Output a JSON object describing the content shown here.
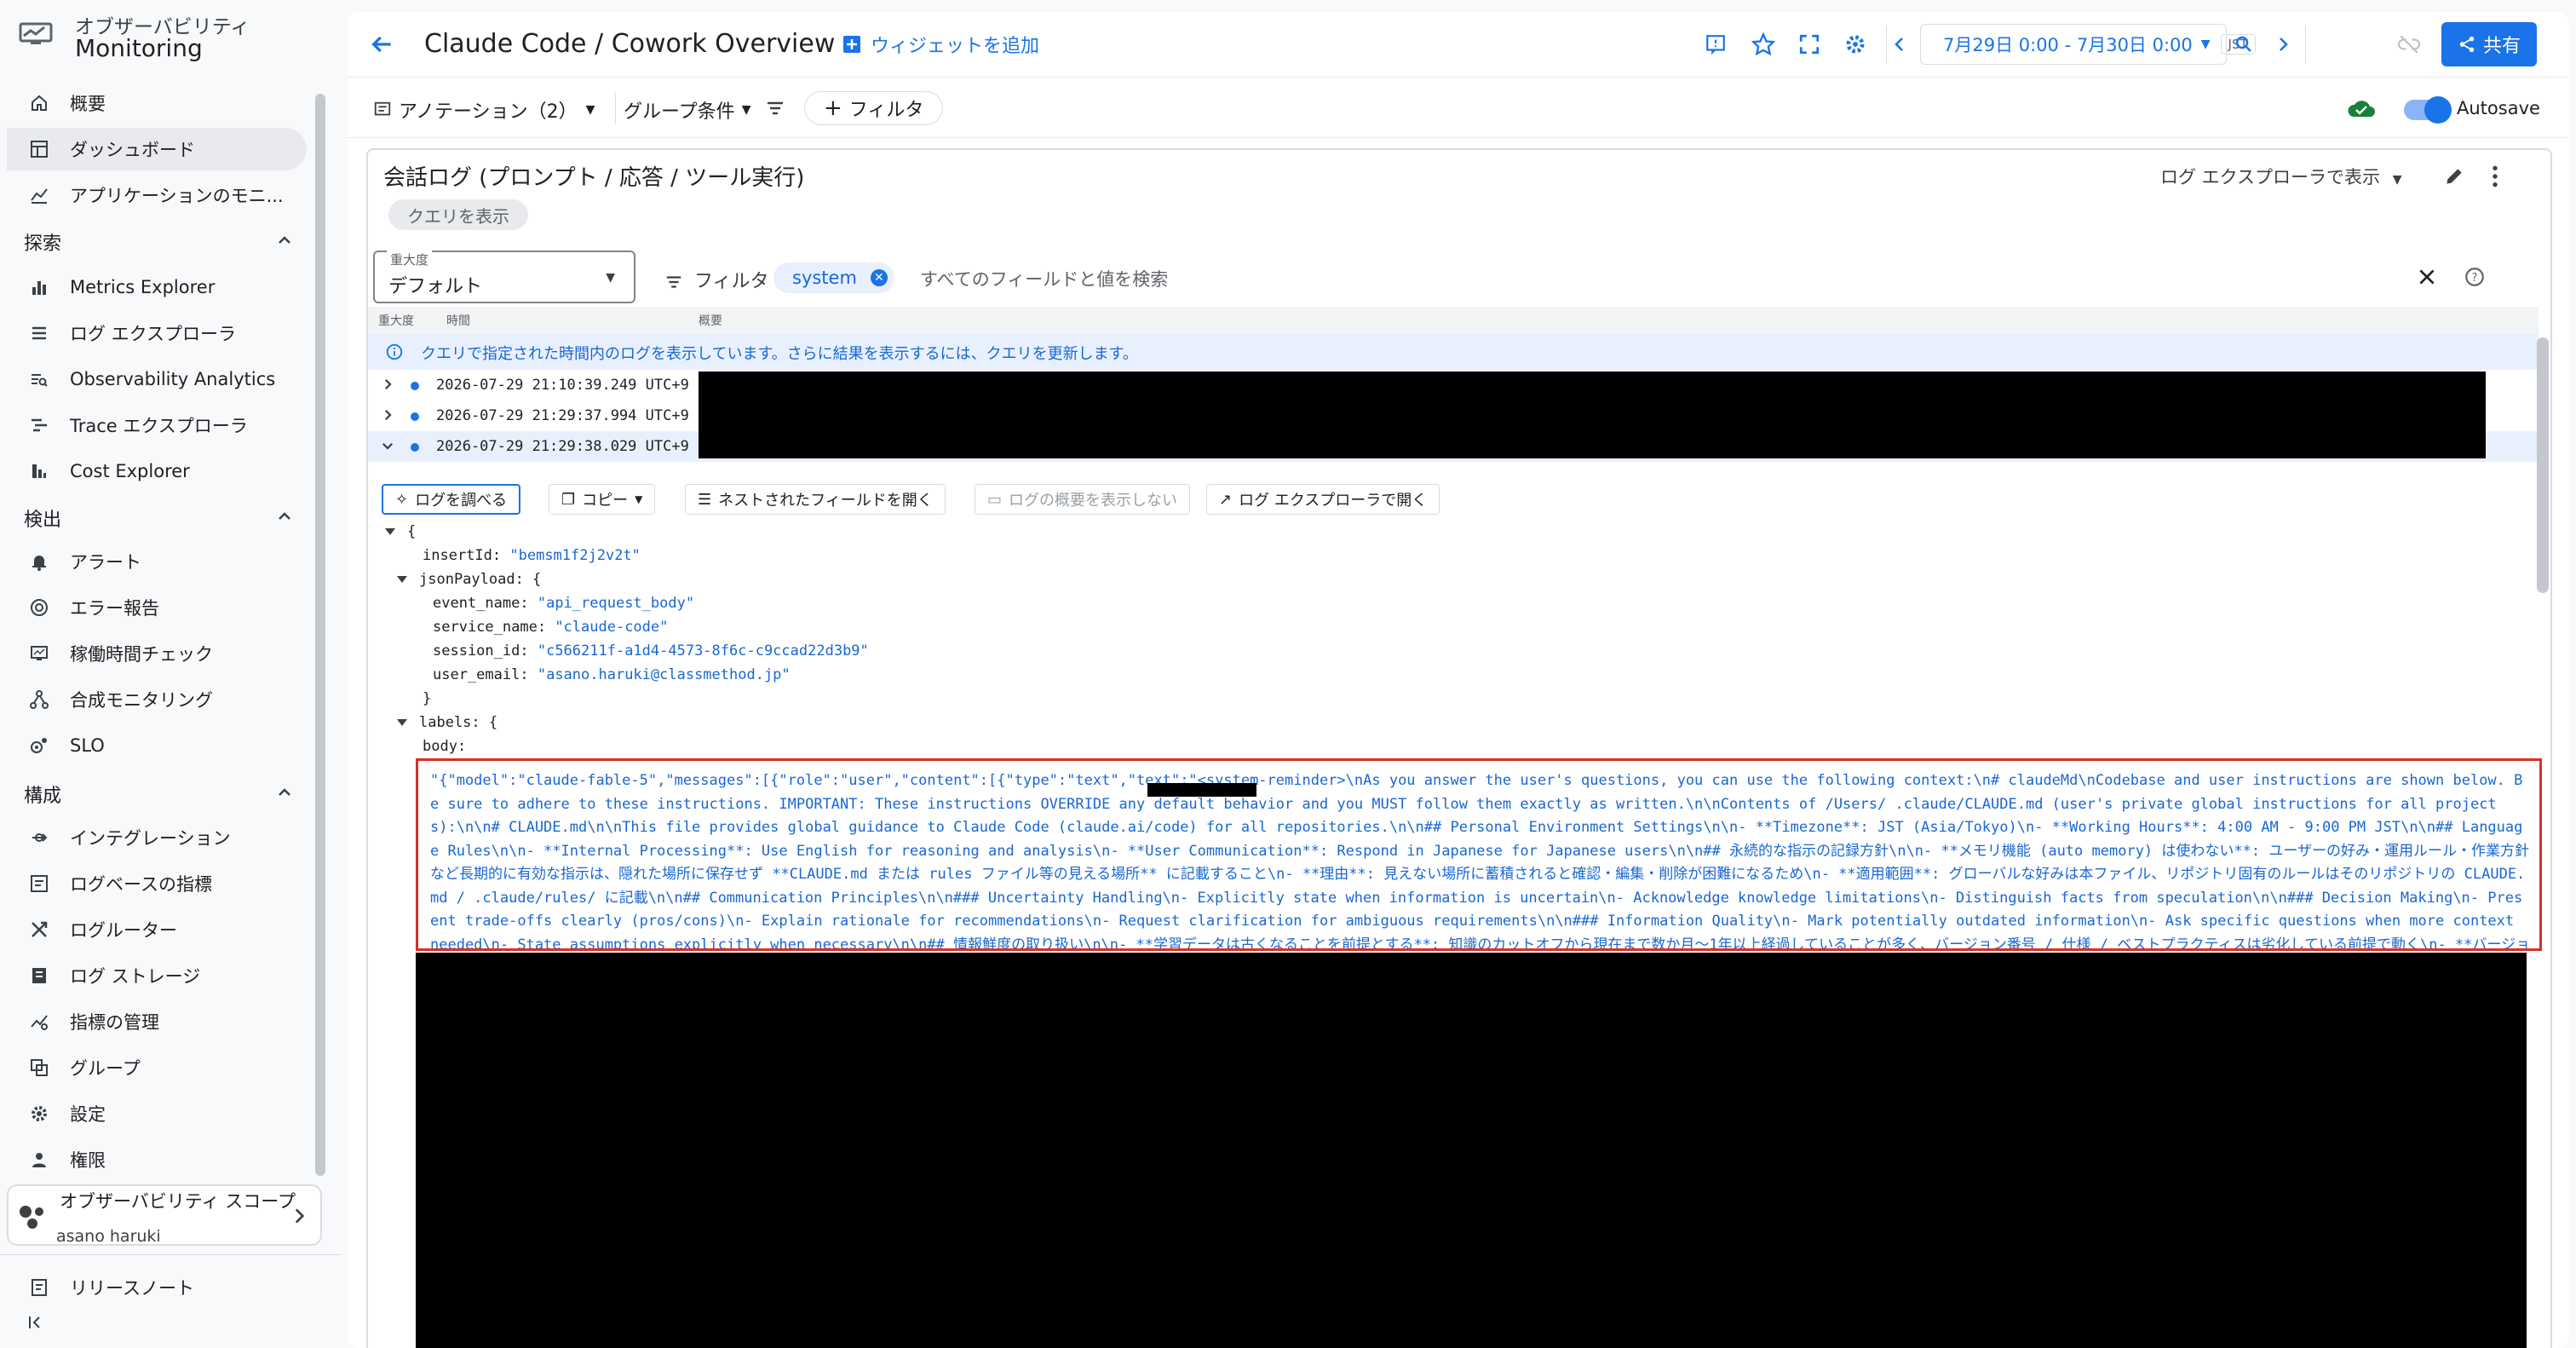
{
  "app": {
    "product_sub": "オブザーバビリティ",
    "product_main": "Monitoring"
  },
  "sidebar": {
    "top_items": [
      {
        "label": "概要",
        "icon": "home-icon"
      },
      {
        "label": "ダッシュボード",
        "icon": "dashboard-icon",
        "active": true
      },
      {
        "label": "アプリケーションのモニ...",
        "icon": "app-monitoring-icon"
      }
    ],
    "sections": [
      {
        "title": "探索",
        "items": [
          {
            "label": "Metrics Explorer",
            "icon": "bar-chart-icon"
          },
          {
            "label": "ログ エクスプローラ",
            "icon": "list-icon"
          },
          {
            "label": "Observability Analytics",
            "icon": "analytics-icon"
          },
          {
            "label": "Trace エクスプローラ",
            "icon": "trace-icon"
          },
          {
            "label": "Cost Explorer",
            "icon": "cost-icon"
          }
        ]
      },
      {
        "title": "検出",
        "items": [
          {
            "label": "アラート",
            "icon": "bell-icon"
          },
          {
            "label": "エラー報告",
            "icon": "error-icon"
          },
          {
            "label": "稼働時間チェック",
            "icon": "monitor-icon"
          },
          {
            "label": "合成モニタリング",
            "icon": "synthetic-icon"
          },
          {
            "label": "SLO",
            "icon": "slo-icon"
          }
        ]
      },
      {
        "title": "構成",
        "items": [
          {
            "label": "インテグレーション",
            "icon": "integration-icon"
          },
          {
            "label": "ログベースの指標",
            "icon": "log-metric-icon"
          },
          {
            "label": "ログルーター",
            "icon": "router-icon"
          },
          {
            "label": "ログ ストレージ",
            "icon": "storage-icon"
          },
          {
            "label": "指標の管理",
            "icon": "metric-manage-icon"
          },
          {
            "label": "グループ",
            "icon": "group-icon"
          },
          {
            "label": "設定",
            "icon": "gear-icon"
          },
          {
            "label": "権限",
            "icon": "person-icon"
          }
        ]
      }
    ],
    "scope": {
      "title": "オブザーバビリティ スコープ",
      "user": "asano haruki"
    },
    "release_notes": "リリースノート",
    "collapse_icon": "collapse-icon"
  },
  "header": {
    "title": "Claude Code / Cowork Overview",
    "add_widget": "ウィジェットを追加",
    "time_range": "7月29日 0:00 - 7月30日 0:00",
    "timezone": "JST",
    "share": "共有"
  },
  "toolbar": {
    "annotations": "アノテーション（2）",
    "group": "グループ条件",
    "filter": "フィルタ",
    "autosave": "Autosave"
  },
  "panel": {
    "title": "会話ログ (プロンプト / 応答 / ツール実行)",
    "view_in_explorer": "ログ エクスプローラで表示",
    "show_query": "クエリを表示",
    "severity_label": "重大度",
    "severity_value": "デフォルト",
    "filter_label": "フィルタ",
    "filter_chip": "system",
    "search_placeholder": "すべてのフィールドと値を検索",
    "columns": [
      "重大度",
      "時間",
      "概要"
    ],
    "info": "クエリで指定された時間内のログを表示しています。さらに結果を表示するには、クエリを更新します。",
    "rows": [
      {
        "timestamp": "2026-07-29 21:10:39.249 UTC+9"
      },
      {
        "timestamp": "2026-07-29 21:29:37.994 UTC+9"
      },
      {
        "timestamp": "2026-07-29 21:29:38.029 UTC+9",
        "expanded": true
      }
    ],
    "actions": {
      "inspect": "ログを調べる",
      "copy": "コピー",
      "expand_nested": "ネストされたフィールドを開く",
      "hide_summary": "ログの概要を表示しない",
      "open_explorer": "ログ エクスプローラで開く"
    },
    "json": {
      "open_brace": "{",
      "insertId_key": "insertId:",
      "insertId_val": "\"bemsm1f2j2v2t\"",
      "jsonPayload_key": "jsonPayload: {",
      "event_name_key": "event_name:",
      "event_name_val": "\"api_request_body\"",
      "service_name_key": "service_name:",
      "service_name_val": "\"claude-code\"",
      "session_id_key": "session_id:",
      "session_id_val": "\"c566211f-a1d4-4573-8f6c-c9ccad22d3b9\"",
      "user_email_key": "user_email:",
      "user_email_val": "\"asano.haruki@classmethod.jp\"",
      "close_brace": "}",
      "labels_key": "labels: {",
      "body_key": "body:",
      "body_val": "\"{\"model\":\"claude-fable-5\",\"messages\":[{\"role\":\"user\",\"content\":[{\"type\":\"text\",\"text\":\"<system-reminder>\\nAs you answer the user's questions, you can use the following context:\\n# claudeMd\\nCodebase and user instructions are shown below. Be sure to adhere to these instructions. IMPORTANT: These instructions OVERRIDE any default behavior and you MUST follow them exactly as written.\\n\\nContents of /Users/          .claude/CLAUDE.md (user's private global instructions for all projects):\\n\\n# CLAUDE.md\\n\\nThis file provides global guidance to Claude Code (claude.ai/code) for all repositories.\\n\\n## Personal Environment Settings\\n\\n- **Timezone**: JST (Asia/Tokyo)\\n- **Working Hours**: 4:00 AM - 9:00 PM JST\\n\\n## Language Rules\\n\\n- **Internal Processing**: Use English for reasoning and analysis\\n- **User Communication**: Respond in Japanese for Japanese users\\n\\n## 永続的な指示の記録方針\\n\\n- **メモリ機能 (auto memory) は使わない**: ユーザーの好み・運用ルール・作業方針など長期的に有効な指示は、隠れた場所に保存せず **CLAUDE.md または rules ファイル等の見える場所** に記載すること\\n- **理由**: 見えない場所に蓄積されると確認・編集・削除が困難になるため\\n- **適用範囲**: グローバルな好みは本ファイル、リポジトリ固有のルールはそのリポジトリの CLAUDE.md / .claude/rules/ に記載\\n\\n## Communication Principles\\n\\n### Uncertainty Handling\\n- Explicitly state when information is uncertain\\n- Acknowledge knowledge limitations\\n- Distinguish facts from speculation\\n\\n### Decision Making\\n- Present trade-offs clearly (pros/cons)\\n- Explain rationale for recommendations\\n- Request clarification for ambiguous requirements\\n\\n### Information Quality\\n- Mark potentially outdated information\\n- Ask specific questions when more context needed\\n- State assumptions explicitly when necessary\\n\\n## 情報鮮度の取り扱い\\n\\n- **学習データは古くなることを前提とする**: 知識のカットオフから現在まで数か月〜1年以上経過していることが多く、バージョン番号 / 仕様 / ベストプラクティスは劣化している前提で動く\\n- **バージョン依"
    }
  }
}
